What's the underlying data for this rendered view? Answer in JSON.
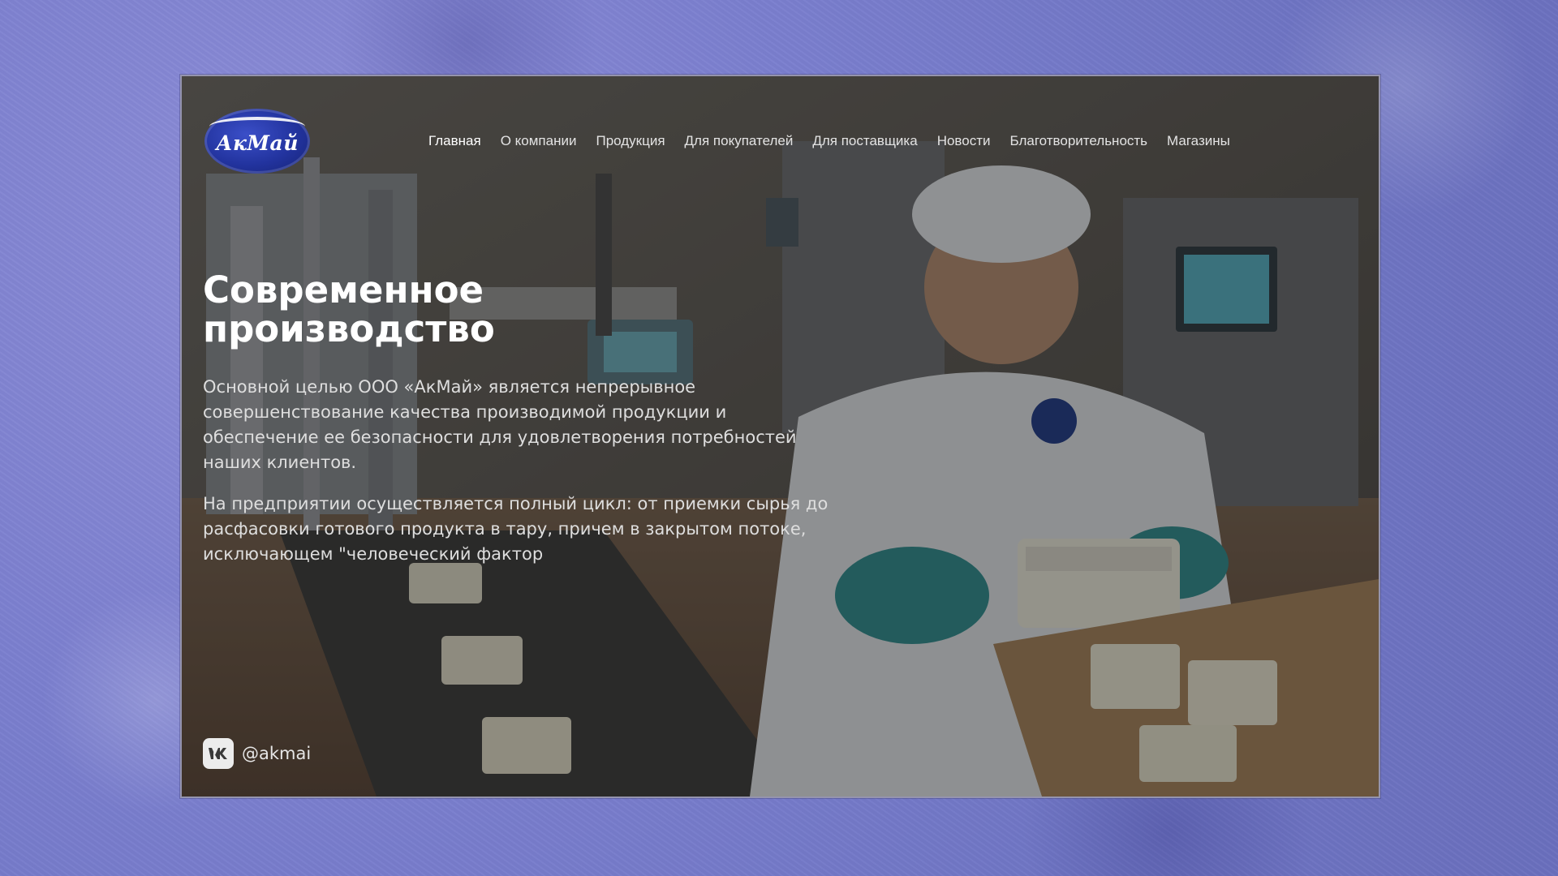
{
  "brand": {
    "logo_text": "АкМай"
  },
  "nav": {
    "items": [
      {
        "label": "Главная",
        "active": true
      },
      {
        "label": "О компании"
      },
      {
        "label": "Продукция"
      },
      {
        "label": "Для покупателей"
      },
      {
        "label": "Для поставщика"
      },
      {
        "label": "Новости"
      },
      {
        "label": "Благотворительность"
      },
      {
        "label": "Магазины"
      }
    ]
  },
  "hero": {
    "title_line1": "Современное",
    "title_line2": "производство",
    "paragraph1": "Основной целью ООО «АкМай» является непрерывное совершенствование качества производимой продукции и обеспечение ее безопасности для удовлетворения потребностей наших клиентов.",
    "paragraph2": "На предприятии осуществляется полный цикл: от приемки сырья до расфасовки готового продукта в тару, причем в закрытом потоке, исключающем \"человеческий фактор"
  },
  "social": {
    "handle": "@akmai",
    "icon": "vk-icon"
  },
  "colors": {
    "logo_blue": "#22339e",
    "page_bg": "#7b7fcf",
    "glove": "#2f8f91"
  }
}
